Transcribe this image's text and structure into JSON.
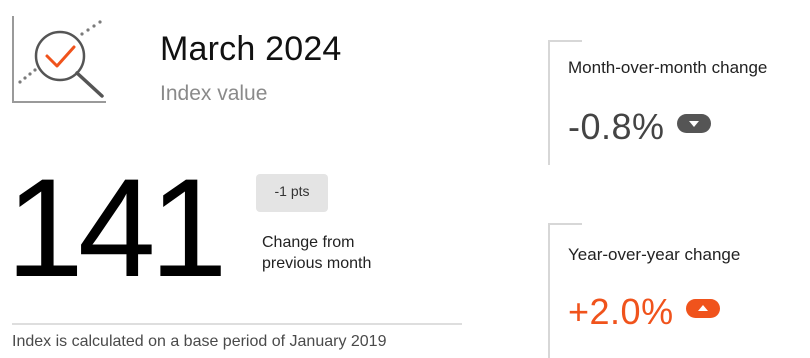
{
  "header": {
    "title": "March 2024",
    "subtitle": "Index value",
    "icon": "magnifier-check-chart-icon"
  },
  "index": {
    "value": "141",
    "change_badge": "-1 pts",
    "change_caption": "Change from previous month"
  },
  "footnote": "Index is calculated on a base period of January 2019",
  "cards": [
    {
      "label": "Month-over-month change",
      "value": "-0.8%",
      "direction": "down",
      "value_color": "#444444",
      "icon": "trend-down-icon",
      "icon_color": "#555555"
    },
    {
      "label": "Year-over-year change",
      "value": "+2.0%",
      "direction": "up",
      "value_color": "#f0531c",
      "icon": "trend-up-icon",
      "icon_color": "#f0531c"
    }
  ],
  "colors": {
    "accent": "#f0531c",
    "muted_text": "#8a8a8a",
    "divider": "#dedede",
    "badge_bg": "#e4e4e4"
  }
}
